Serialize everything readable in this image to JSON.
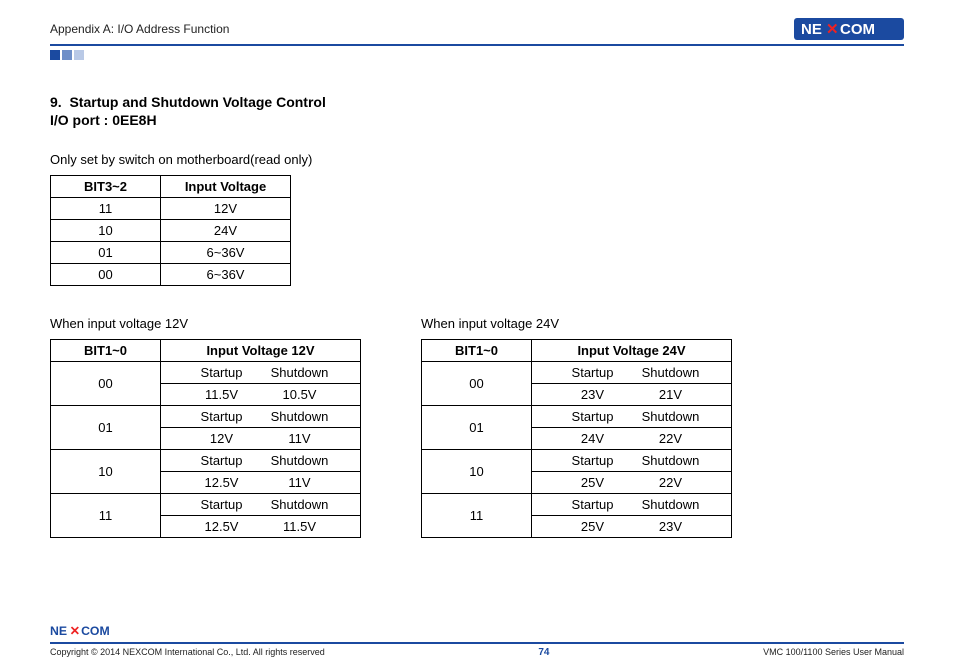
{
  "header": {
    "appendix": "Appendix A: I/O Address Function",
    "brand": "NEXCOM"
  },
  "section": {
    "number": "9.",
    "title": "Startup and Shutdown Voltage Control",
    "io_port_label": "I/O port : 0EE8H",
    "note": "Only set by switch on motherboard(read only)"
  },
  "table1": {
    "headers": [
      "BIT3~2",
      "Input Voltage"
    ],
    "rows": [
      [
        "11",
        "12V"
      ],
      [
        "10",
        "24V"
      ],
      [
        "01",
        "6~36V"
      ],
      [
        "00",
        "6~36V"
      ]
    ]
  },
  "col_left": {
    "label": "When input voltage 12V",
    "headers": [
      "BIT1~0",
      "Input Voltage 12V"
    ],
    "sub": [
      "Startup",
      "Shutdown"
    ],
    "rows": [
      {
        "bit": "00",
        "startup": "11.5V",
        "shutdown": "10.5V"
      },
      {
        "bit": "01",
        "startup": "12V",
        "shutdown": "11V"
      },
      {
        "bit": "10",
        "startup": "12.5V",
        "shutdown": "11V"
      },
      {
        "bit": "11",
        "startup": "12.5V",
        "shutdown": "11.5V"
      }
    ]
  },
  "col_right": {
    "label": "When input voltage 24V",
    "headers": [
      "BIT1~0",
      "Input Voltage 24V"
    ],
    "sub": [
      "Startup",
      "Shutdown"
    ],
    "rows": [
      {
        "bit": "00",
        "startup": "23V",
        "shutdown": "21V"
      },
      {
        "bit": "01",
        "startup": "24V",
        "shutdown": "22V"
      },
      {
        "bit": "10",
        "startup": "25V",
        "shutdown": "22V"
      },
      {
        "bit": "11",
        "startup": "25V",
        "shutdown": "23V"
      }
    ]
  },
  "footer": {
    "copyright": "Copyright © 2014 NEXCOM International Co., Ltd. All rights reserved",
    "page": "74",
    "manual": "VMC 100/1100 Series User Manual"
  }
}
